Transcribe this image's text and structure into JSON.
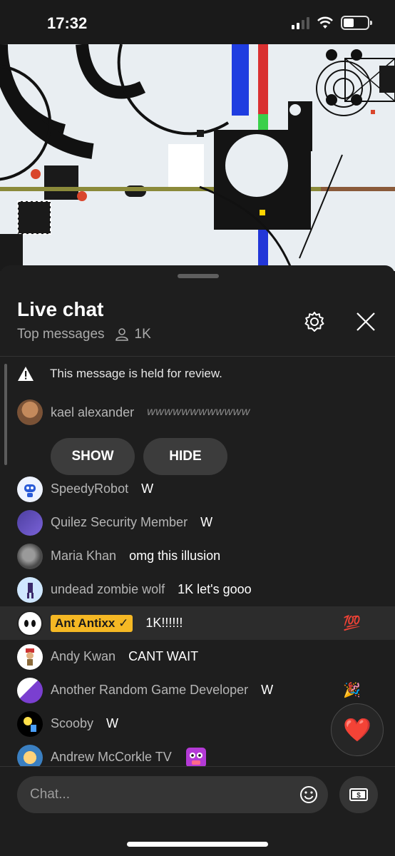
{
  "status_bar": {
    "time": "17:32"
  },
  "chat": {
    "title": "Live chat",
    "filter": "Top messages",
    "viewers": "1K",
    "input_placeholder": "Chat..."
  },
  "held_message": {
    "notice": "This message is held for review.",
    "author": "kael alexander",
    "text": "wwwwwwwwwwww",
    "show_label": "SHOW",
    "hide_label": "HIDE"
  },
  "messages": [
    {
      "author": "SpeedyRobot",
      "text": "W",
      "avatar_color": "#e8f0ff"
    },
    {
      "author": "Quilez Security Member",
      "text": "W",
      "avatar_color": "#5a4aa8"
    },
    {
      "author": "Maria Khan",
      "text": "omg this illusion",
      "avatar_color": "#6a6a6a"
    },
    {
      "author": "undead zombie wolf",
      "text": "1K let's gooo",
      "avatar_color": "#cfe7ff"
    },
    {
      "author": "Ant Antixx ✓",
      "text": "1K!!!!!!",
      "avatar_color": "#ffffff",
      "highlight": true,
      "badge": true,
      "float_emoji": "💯"
    },
    {
      "author": "Andy Kwan",
      "text": "CANT WAIT",
      "avatar_color": "#ffffff"
    },
    {
      "author": "Another Random Game Developer",
      "text": "W",
      "avatar_color": "#8a4fd6",
      "float_emoji": "🎉"
    },
    {
      "author": "Scooby",
      "text": "W",
      "avatar_color": "#000000"
    },
    {
      "author": "Andrew McCorkle TV",
      "text": "",
      "avatar_color": "#3a7fc1",
      "sticker": true
    }
  ],
  "reaction_emoji": "❤️",
  "colors": {
    "background": "#1e1e1e",
    "badge": "#f5b824",
    "pill": "#3c3c3c"
  }
}
